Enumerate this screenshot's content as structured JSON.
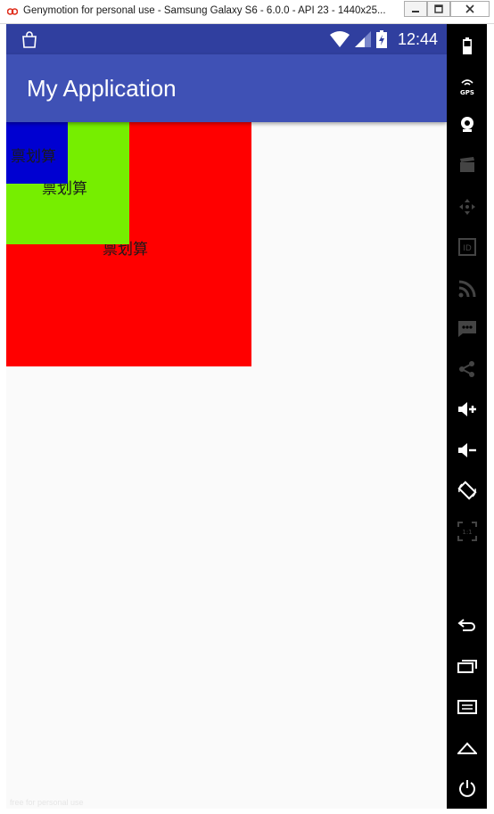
{
  "window": {
    "title": "Genymotion for personal use - Samsung Galaxy S6 - 6.0.0 - API 23 - 1440x25...",
    "minimize_glyph": "▭",
    "maximize_glyph": "□",
    "close_glyph": "✕"
  },
  "statusbar": {
    "time": "12:44"
  },
  "appbar": {
    "title": "My Application"
  },
  "boxes": {
    "red": {
      "label": "禀划算",
      "color": "#ff0000"
    },
    "green": {
      "label": "禀划算",
      "color": "#76ee00"
    },
    "blue": {
      "label": "禀划算",
      "color": "#0000d1"
    }
  },
  "watermark": "free for personal use",
  "sidebar": {
    "items": [
      "battery-icon",
      "gps-icon",
      "webcam-icon",
      "screencast-icon",
      "dpad-icon",
      "device-id-icon",
      "network-icon",
      "sms-icon",
      "share-icon",
      "volume-up-icon",
      "volume-down-icon",
      "rotate-icon",
      "pixel-perfect-icon",
      "back-icon",
      "recent-apps-icon",
      "menu-icon",
      "home-icon",
      "power-icon"
    ]
  }
}
